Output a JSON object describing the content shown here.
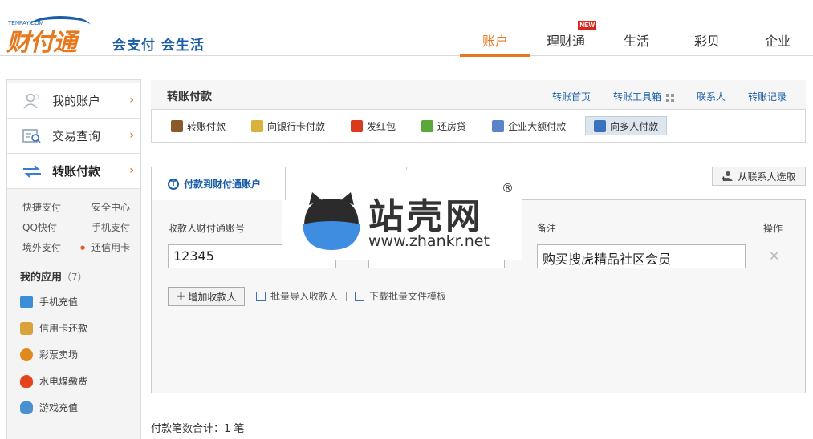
{
  "header": {
    "logo_small": "TENPAY.COM",
    "logo_brand": "财付通",
    "slogan": "会支付 会生活",
    "nav": [
      {
        "label": "账户",
        "active": true
      },
      {
        "label": "理财通",
        "badge": "NEW"
      },
      {
        "label": "生活"
      },
      {
        "label": "彩贝"
      },
      {
        "label": "企业"
      }
    ]
  },
  "sidebar": {
    "main": [
      {
        "label": "我的账户",
        "icon": "user-icon"
      },
      {
        "label": "交易查询",
        "icon": "search-document-icon"
      },
      {
        "label": "转账付款",
        "icon": "transfer-arrows-icon",
        "active": true
      }
    ],
    "quick": [
      "快捷支付",
      "安全中心",
      "QQ快付",
      "手机支付",
      "境外支付",
      "还信用卡"
    ],
    "apps_title": "我的应用",
    "apps_count": "（7）",
    "apps": [
      {
        "label": "手机充值",
        "icon": "phone-recharge-icon",
        "color": "#3d8ed8"
      },
      {
        "label": "信用卡还款",
        "icon": "credit-card-icon",
        "color": "#d9a23a"
      },
      {
        "label": "彩票卖场",
        "icon": "lottery-ball-icon",
        "color": "#e08a1e"
      },
      {
        "label": "水电煤缴费",
        "icon": "flame-icon",
        "color": "#e2451c"
      },
      {
        "label": "游戏充值",
        "icon": "gamepad-icon",
        "color": "#4a8fd0"
      }
    ]
  },
  "main": {
    "title": "转账付款",
    "head_links": [
      "转账首页",
      "转账工具箱",
      "联系人",
      "转账记录"
    ],
    "sub_tabs": [
      {
        "label": "转账付款",
        "icon": "wallet-icon",
        "color": "#8a5a2a"
      },
      {
        "label": "向银行卡付款",
        "icon": "bank-card-icon",
        "color": "#d8b23a"
      },
      {
        "label": "发红包",
        "icon": "red-envelope-icon",
        "color": "#d83a1e"
      },
      {
        "label": "还房贷",
        "icon": "house-icon",
        "color": "#5aa83a"
      },
      {
        "label": "企业大额付款",
        "icon": "enterprise-icon",
        "color": "#5a84c8"
      },
      {
        "label": "向多人付款",
        "icon": "multi-user-icon",
        "color": "#3a72c0",
        "active": true
      }
    ],
    "contact_button": "从联系人选取",
    "form_tab": "付款到财付通账户",
    "columns": {
      "account": "收款人财付通账号",
      "remark": "备注",
      "action": "操作"
    },
    "row": {
      "account": "12345",
      "amount": "",
      "remark": "购买搜虎精品社区会员"
    },
    "add_button": "增加收款人",
    "batch_import": "批量导入收款人",
    "download_template": "下载批量文件模板",
    "summary": "付款笔数合计：1 笔"
  },
  "watermark": {
    "cn": "站壳网",
    "url": "www.zhankr.net",
    "reg": "®"
  }
}
